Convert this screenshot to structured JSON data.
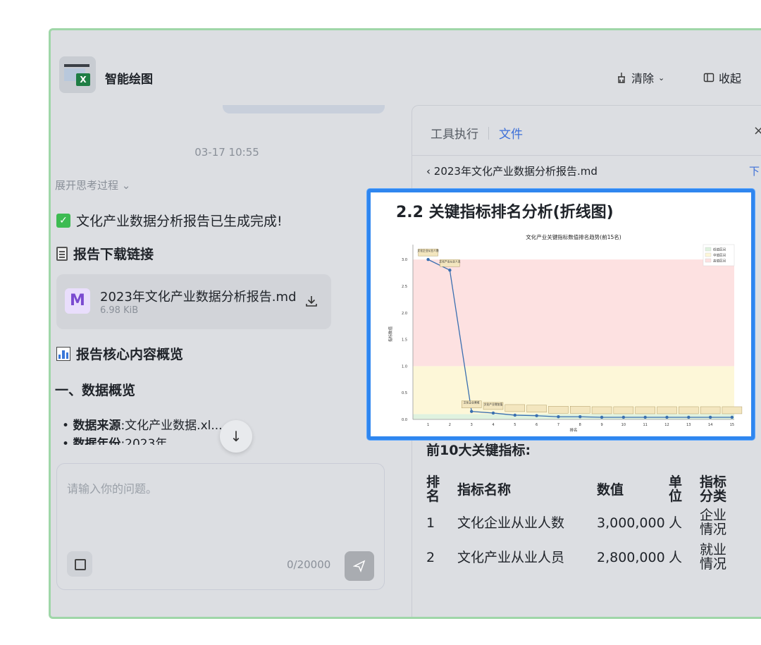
{
  "app": {
    "title": "智能绘图"
  },
  "header": {
    "clear_label": "清除",
    "collapse_label": "收起"
  },
  "chat": {
    "timestamp": "03-17 10:55",
    "thinking_toggle": "展开思考过程",
    "done_message": "文化产业数据分析报告已生成完成!",
    "download_heading": "报告下载链接",
    "file": {
      "name": "2023年文化产业数据分析报告.md",
      "size": "6.98 KiB"
    },
    "overview_heading": "报告核心内容概览",
    "section_heading": "一、数据概览",
    "bullets": [
      {
        "label": "数据来源",
        "text": ":文化产业数据.xl..."
      },
      {
        "label": "数据年份",
        "text": ":2023年"
      }
    ],
    "input_placeholder": "请输入你的问题。",
    "char_counter": "0/20000"
  },
  "panel": {
    "tab_tools": "工具执行",
    "tab_file": "文件",
    "breadcrumb": "2023年文化产业数据分析报告.md",
    "download_link": "下",
    "section_title": "2.2 关键指标排名分析(折线图)",
    "subheading": "前10大关键指标:",
    "table": {
      "headers": [
        "排名",
        "指标名称",
        "数值",
        "单位",
        "指标分类"
      ],
      "rows": [
        [
          "1",
          "文化企业从业人数",
          "3,000,000",
          "人",
          "企业情况"
        ],
        [
          "2",
          "文化产业从业人员",
          "2,800,000",
          "人",
          "就业情况"
        ]
      ]
    }
  },
  "chart_data": {
    "type": "line",
    "title": "文化产业关键指标数值排名趋势(前15名)",
    "xlabel": "排名",
    "ylabel": "指标数值",
    "x": [
      1,
      2,
      3,
      4,
      5,
      6,
      7,
      8,
      9,
      10,
      11,
      12,
      13,
      14,
      15
    ],
    "values": [
      3.0,
      2.8,
      0.15,
      0.12,
      0.08,
      0.07,
      0.05,
      0.05,
      0.04,
      0.04,
      0.04,
      0.04,
      0.04,
      0.04,
      0.04
    ],
    "ylim": [
      0,
      3.2
    ],
    "yticks": [
      "0.0",
      "0.5",
      "1.0",
      "1.5",
      "2.0",
      "2.5",
      "3.0"
    ],
    "bands": [
      {
        "name": "低值区间",
        "from": 0,
        "to": 0.1,
        "color": "#dff2df"
      },
      {
        "name": "中值区间",
        "from": 0.1,
        "to": 1.0,
        "color": "#fdf7d8"
      },
      {
        "name": "高值区间",
        "from": 1.0,
        "to": 3.0,
        "color": "#fde1e1"
      }
    ],
    "annotations": [
      "文化企业从业人数",
      "文化产业从业人员",
      "文化企业营收",
      "文化产业增加值"
    ],
    "legend_position": "top-right",
    "line_color": "#3a6fb0"
  }
}
